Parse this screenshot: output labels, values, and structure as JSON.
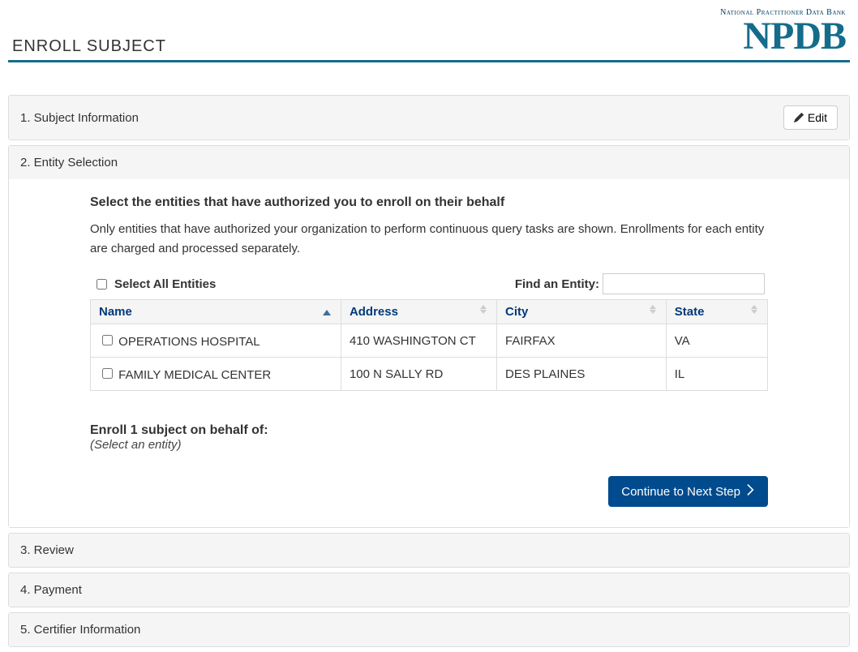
{
  "header": {
    "title": "ENROLL SUBJECT",
    "logo_small": "National Practitioner Data Bank",
    "logo_big": "NPDB"
  },
  "steps": {
    "s1": {
      "title": "1. Subject Information",
      "edit_label": "Edit"
    },
    "s2": {
      "title": "2. Entity Selection",
      "instruction_title": "Select the entities that have authorized you to enroll on their behalf",
      "instruction_text": "Only entities that have authorized your organization to perform continuous query tasks are shown.   Enrollments for each entity are charged and processed separately.",
      "select_all_label": "Select All Entities",
      "find_entity_label": "Find an Entity:",
      "find_entity_value": "",
      "columns": {
        "name": "Name",
        "address": "Address",
        "city": "City",
        "state": "State"
      },
      "rows": [
        {
          "name": "OPERATIONS HOSPITAL",
          "address": "410 WASHINGTON CT",
          "city": "FAIRFAX",
          "state": "VA"
        },
        {
          "name": "FAMILY MEDICAL CENTER",
          "address": "100 N SALLY RD",
          "city": "DES PLAINES",
          "state": "IL"
        }
      ],
      "enroll_summary_title": "Enroll 1 subject on behalf of:",
      "enroll_summary_sub": "(Select an entity)",
      "continue_label": "Continue to Next Step"
    },
    "s3": {
      "title": "3. Review"
    },
    "s4": {
      "title": "4. Payment"
    },
    "s5": {
      "title": "5. Certifier Information"
    }
  }
}
